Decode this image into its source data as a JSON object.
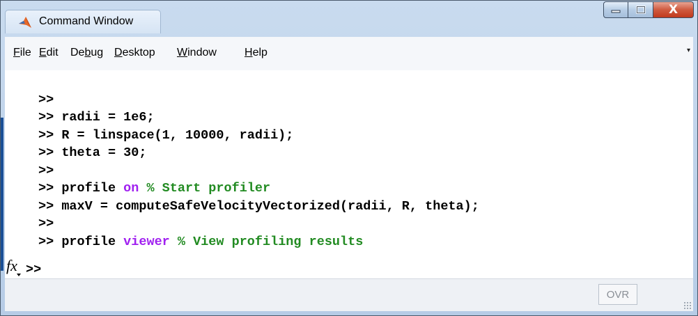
{
  "window": {
    "title": "Command Window",
    "controls": {
      "minimize": "minimize",
      "maximize": "maximize",
      "close": "X"
    }
  },
  "menu": {
    "items": [
      {
        "label": "ile",
        "u": "F"
      },
      {
        "label": "dit",
        "u": "E",
        "pre": ""
      },
      {
        "label": "Debug"
      },
      {
        "label": "esktop",
        "u": "D"
      },
      {
        "label": "indow",
        "u": "W"
      },
      {
        "label": "elp",
        "u": "H"
      }
    ],
    "file": "File",
    "edit": "Edit",
    "debug_pre": "De",
    "debug_u": "b",
    "debug_post": "ug",
    "desktop": "Desktop",
    "window": "Window",
    "help": "Help",
    "overflow_arrow": "▾"
  },
  "console": {
    "prompt": ">>",
    "lines": [
      {
        "code": ""
      },
      {
        "code": "radii = 1e6;"
      },
      {
        "code": "R = linspace(1, 10000, radii);"
      },
      {
        "code": "theta = 30;"
      },
      {
        "code": ""
      },
      {
        "pre": "profile ",
        "kw": "on",
        "cm": " % Start profiler"
      },
      {
        "code": "maxV = computeSafeVelocityVectorized(radii, R, theta);"
      },
      {
        "code": ""
      },
      {
        "pre": "profile ",
        "kw": "viewer",
        "cm": " % View profiling results"
      }
    ],
    "current_prompt": ">>"
  },
  "status": {
    "ovr": "OVR"
  },
  "colors": {
    "keyword": "#a020f0",
    "comment": "#228b22",
    "accent": "#1a4f96"
  },
  "icons": {
    "app": "matlab-logo-icon",
    "fx": "fx-function-browser-icon"
  }
}
